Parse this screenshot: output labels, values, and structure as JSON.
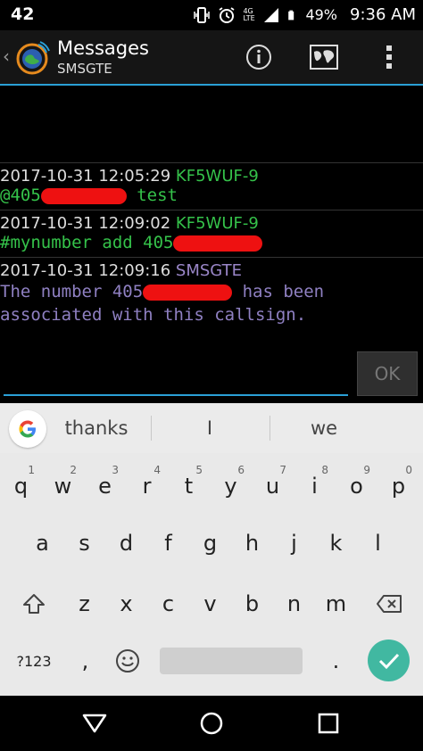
{
  "status_bar": {
    "notification_count": "42",
    "network": "4G LTE",
    "battery": "49%",
    "time": "9:36 AM",
    "icons": [
      "vibrate-icon",
      "alarm-icon",
      "signal-icon",
      "battery-icon"
    ]
  },
  "app_bar": {
    "title": "Messages",
    "subtitle": "SMSGTE",
    "actions": [
      "info-icon",
      "map-icon",
      "overflow-menu-icon"
    ],
    "accent_color": "#2aa0d6"
  },
  "messages": [
    {
      "timestamp": "2017-10-31 12:05:29",
      "sender": "KF5WUF-9",
      "body_prefix": "@405",
      "body_suffix": " test",
      "color": "#35c24a"
    },
    {
      "timestamp": "2017-10-31 12:09:02",
      "sender": "KF5WUF-9",
      "body_prefix": "#mynumber add 405",
      "body_suffix": "",
      "color": "#35c24a"
    },
    {
      "timestamp": "2017-10-31 12:09:16",
      "sender": "SMSGTE",
      "body_prefix": "The number 405",
      "body_suffix": " has been associated with this callsign.",
      "color": "#8f80c2"
    }
  ],
  "compose": {
    "input_value": "",
    "ok_label": "OK"
  },
  "suggestions": [
    "thanks",
    "I",
    "we"
  ],
  "keyboard": {
    "row1": [
      {
        "k": "q",
        "n": "1"
      },
      {
        "k": "w",
        "n": "2"
      },
      {
        "k": "e",
        "n": "3"
      },
      {
        "k": "r",
        "n": "4"
      },
      {
        "k": "t",
        "n": "5"
      },
      {
        "k": "y",
        "n": "6"
      },
      {
        "k": "u",
        "n": "7"
      },
      {
        "k": "i",
        "n": "8"
      },
      {
        "k": "o",
        "n": "9"
      },
      {
        "k": "p",
        "n": "0"
      }
    ],
    "row2": [
      "a",
      "s",
      "d",
      "f",
      "g",
      "h",
      "j",
      "k",
      "l"
    ],
    "row3": [
      "z",
      "x",
      "c",
      "v",
      "b",
      "n",
      "m"
    ],
    "symbols_label": "?123",
    "comma": ",",
    "period": ".",
    "enter_color": "#41b8a1"
  },
  "nav_bar": [
    "back-icon",
    "home-icon",
    "recents-icon"
  ]
}
